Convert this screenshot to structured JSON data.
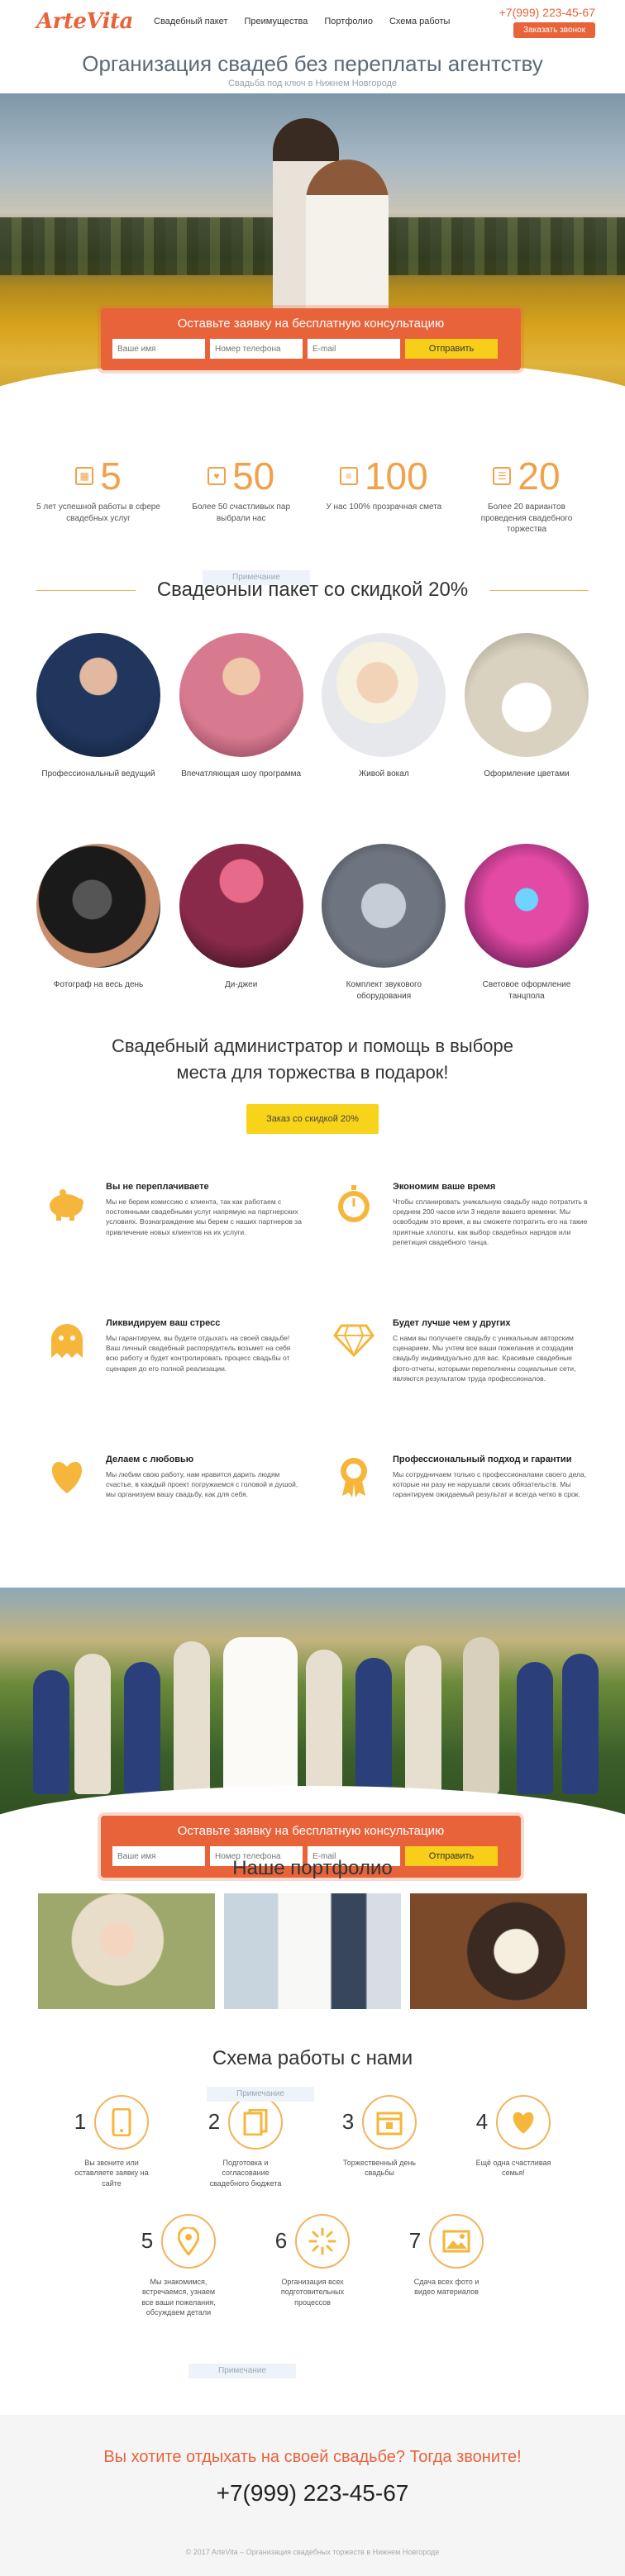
{
  "header": {
    "logo": "ArteVita",
    "nav": [
      "Свадебный пакет",
      "Преимущества",
      "Портфолио",
      "Схема работы"
    ],
    "phone": "+7(999) 223-45-67",
    "call_button": "Заказать звонок"
  },
  "hero": {
    "title": "Организация свадеб без переплаты агентству",
    "subtitle": "Свадьба под ключ в Нижнем Новгороде"
  },
  "form": {
    "title": "Оставьте заявку на бесплатную консультацию",
    "name_placeholder": "Ваше имя",
    "phone_placeholder": "Номер телефона",
    "email_placeholder": "E-mail",
    "submit": "Отправить"
  },
  "stats": [
    {
      "num": "5",
      "desc": "5 лет успешной работы в сфере свадебных услуг",
      "icon": "calendar-icon"
    },
    {
      "num": "50",
      "desc": "Более 50 счастливых пар выбрали нас",
      "icon": "hearts-icon"
    },
    {
      "num": "100",
      "desc": "У нас 100% прозрачная смета",
      "icon": "document-icon"
    },
    {
      "num": "20",
      "desc": "Более 20 вариантов проведения свадебного торжества",
      "icon": "list-icon"
    }
  ],
  "package": {
    "title": "Свадебный пакет со скидкой 20%",
    "ghost": "Примечание",
    "items_row1": [
      {
        "cap": "Профессиональный ведущий",
        "color": "#20365c"
      },
      {
        "cap": "Впечатляющая шоу программа",
        "color": "#c05a7c"
      },
      {
        "cap": "Живой вокал",
        "color": "#f2efe9"
      },
      {
        "cap": "Оформление цветами",
        "color": "#d9d2c0"
      }
    ],
    "items_row2": [
      {
        "cap": "Фотограф на весь день",
        "color": "#2a2a2a"
      },
      {
        "cap": "Ди-джеи",
        "color": "#8a2a4a"
      },
      {
        "cap": "Комплект звукового оборудования",
        "color": "#6f7580"
      },
      {
        "cap": "Световое оформление танцпола",
        "color": "#b2245f"
      }
    ]
  },
  "gift": {
    "line1": "Свадебный администратор и помощь в выборе",
    "line2": "места для торжества в подарок!",
    "button": "Заказ со скидкой 20%"
  },
  "benefits": [
    {
      "title": "Вы не переплачиваете",
      "text": "Мы не берем комиссию с клиента, так как работаем с постоянными свадебными услуг напрямую на партнерских условиях. Вознаграждение мы берем с наших партнеров за привлечение новых клиентов на их услуги.",
      "icon": "piggy-bank-icon"
    },
    {
      "title": "Экономим ваше время",
      "text": "Чтобы спланировать уникальную свадьбу надо потратить в среднем 200 часов или 3 недели вашего времени. Мы освободим это время, а вы сможете потратить его на такие приятные хлопоты, как выбор свадебных нарядов или репетиция свадебного танца.",
      "icon": "stopwatch-icon"
    },
    {
      "title": "Ликвидируем ваш стресс",
      "text": "Мы гарантируем, вы будете отдыхать на своей свадьбе! Ваш личный свадебный распорядитель возьмет на себя всю работу и будет контролировать процесс свадьбы от сценария до его полной реализации.",
      "icon": "ghost-icon"
    },
    {
      "title": "Будет лучше чем у других",
      "text": "С нами вы получаете свадьбу с уникальным авторским сценарием. Мы учтем все ваши пожелания и создадим свадьбу индивидуально для вас. Красивые свадебные фото-отчеты, которыми переполнены социальные сети, являются результатом труда профессионалов.",
      "icon": "diamond-icon"
    },
    {
      "title": "Делаем с любовью",
      "text": "Мы любим свою работу, нам нравится дарить людям счастье, в каждый проект погружаемся с головой и душой, мы организуем вашу свадьбу, как для себя.",
      "icon": "heart-icon"
    },
    {
      "title": "Профессиональный подход и гарантии",
      "text": "Мы сотрудничаем только с профессионалами своего дела, которые ни разу не нарушали своих обязательств. Мы гарантируем ожидаемый результат и всегда четко в срок.",
      "icon": "medal-icon"
    }
  ],
  "portfolio": {
    "title": "Наше портфолио",
    "ghost": "Примечание"
  },
  "scheme": {
    "title": "Схема работы с нами",
    "ghost": "Примечание",
    "steps": [
      {
        "n": "1",
        "desc": "Вы звоните или оставляете заявку на сайте",
        "icon": "phone-icon"
      },
      {
        "n": "2",
        "desc": "Подготовка и согласование свадебного бюджета",
        "icon": "documents-icon"
      },
      {
        "n": "3",
        "desc": "Торжественный день свадьбы",
        "icon": "calendar-icon"
      },
      {
        "n": "4",
        "desc": "Ещё одна счастливая семья!",
        "icon": "heart-icon"
      },
      {
        "n": "5",
        "desc": "Мы знакомимся, встречаемся, узнаем все ваши пожелания, обсуждаем детали",
        "icon": "map-pin-icon"
      },
      {
        "n": "6",
        "desc": "Организация всех подготовительных процессов",
        "icon": "spinner-icon"
      },
      {
        "n": "7",
        "desc": "Сдача всех фото и видео материалов",
        "icon": "image-icon"
      }
    ]
  },
  "footer": {
    "question": "Вы хотите отдыхать на своей свадьбе? Тогда звоните!",
    "phone": "+7(999) 223-45-67",
    "copyright": "© 2017 ArteVita – Организация свадебных торжеств в Нижнем Новгороде"
  },
  "colors": {
    "accent": "#e8633a",
    "yellow": "#f7d31a",
    "gold": "#f0a14a"
  }
}
